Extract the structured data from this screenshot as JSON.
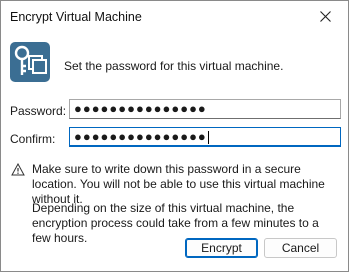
{
  "window": {
    "title": "Encrypt Virtual Machine"
  },
  "intro_text": "Set the password for this virtual machine.",
  "form": {
    "password_label": "Password:",
    "password_value": "●●●●●●●●●●●●●●●",
    "confirm_label": "Confirm:",
    "confirm_value": "●●●●●●●●●●●●●●●"
  },
  "messages": {
    "warning": "Make sure to write down this password in a secure location. You will not be able to use this virtual machine without it.",
    "info": "Depending on the size of this virtual machine, the encryption process could take from a few minutes to a few hours."
  },
  "buttons": {
    "encrypt": "Encrypt",
    "cancel": "Cancel"
  },
  "colors": {
    "accent": "#0067c0",
    "icon": "#3b6e93"
  }
}
